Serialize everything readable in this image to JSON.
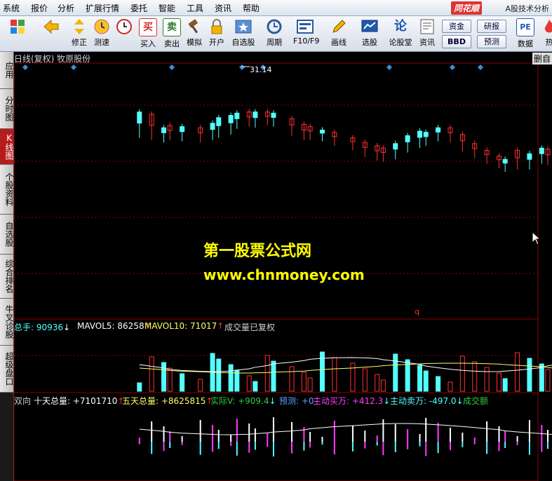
{
  "menu": [
    "系统",
    "报价",
    "分析",
    "扩展行情",
    "委托",
    "智能",
    "工具",
    "资讯",
    "帮助"
  ],
  "brand": {
    "logo_text": "同花顺",
    "subtitle": "A股技术分析"
  },
  "toolbar": {
    "buttons": [
      {
        "label": "",
        "icon": "windows-icon"
      },
      {
        "label": "",
        "icon": "back-arrow-icon"
      },
      {
        "label": "修正",
        "icon": "up-down-arrows-icon"
      },
      {
        "label": "测速",
        "icon": "clock-icon"
      },
      {
        "label": "买入",
        "icon": "buy-icon",
        "glyph": "买"
      },
      {
        "label": "卖出",
        "icon": "sell-icon",
        "glyph": "卖"
      },
      {
        "label": "模拟",
        "icon": "gavel-icon"
      },
      {
        "label": "开户",
        "icon": "lock-icon"
      },
      {
        "label": "自选股",
        "icon": "star-icon"
      },
      {
        "label": "周期",
        "icon": "cycle-icon"
      },
      {
        "label": "F10/F9",
        "icon": "f10-icon"
      },
      {
        "label": "画线",
        "icon": "pencil-icon"
      },
      {
        "label": "选股",
        "icon": "screen-icon"
      },
      {
        "label": "论股堂",
        "icon": "forum-icon"
      },
      {
        "label": "资讯",
        "icon": "news-icon"
      }
    ],
    "small_buttons": [
      "资金",
      "研报",
      "BBD",
      "预测"
    ],
    "right_buttons": [
      {
        "label": "数据",
        "icon": "pe-icon",
        "glyph": "PE"
      },
      {
        "label": "热",
        "icon": "hot-icon"
      }
    ]
  },
  "sidebar": {
    "tabs": [
      "应用",
      "分时图",
      "K线图",
      "个股资料",
      "自选股",
      "综合排名",
      "牛叉诊股",
      "超级盘口"
    ],
    "active_index": 2
  },
  "chart_title": "日线(复权)  牧原股份",
  "corner_button": "删自",
  "price_high_label": "31.14",
  "price_low_marker": "q",
  "volume_legend": {
    "total": "总手: 90936",
    "total_arrow": "↓",
    "mavol5": "MAVOL5: 86258",
    "mavol5_arrow": "↑",
    "mavol10": "MAVOL10: 71017",
    "mavol10_arrow": "↑",
    "note": "成交量已复权"
  },
  "bottom_legend": {
    "title": "双向",
    "ten_day": "十天总量: +7101710",
    "ten_day_arrow": "↑",
    "five_day": "五天总量: +8625815",
    "five_day_arrow": "↑",
    "actual": "实际V: +909.4",
    "actual_arrow": "↓",
    "predict": "预测: +0",
    "buy": "主动买万: +412.3",
    "buy_arrow": "↓",
    "sell": "主动卖万: -497.0",
    "sell_arrow": "↓",
    "deal": "成交额"
  },
  "watermark": {
    "line1": "第一股票公式网",
    "line2": "www.chnmoney.com"
  },
  "colors": {
    "up": "#ff3030",
    "down": "#54ffff",
    "background": "#000000",
    "grid": "#8a0000",
    "ma5": "#ffffff",
    "ma10": "#ffff66",
    "marker": "#3a8fd8",
    "pink": "#ff3cff"
  },
  "candles": [
    [
      20,
      25,
      12,
      30,
      "d"
    ],
    [
      22,
      20,
      10,
      28,
      "u"
    ],
    [
      24,
      13,
      8,
      16,
      "d"
    ],
    [
      25,
      14,
      10,
      18,
      "u"
    ],
    [
      27,
      13,
      9,
      17,
      "d"
    ],
    [
      30,
      12,
      8,
      16,
      "u"
    ],
    [
      32,
      13,
      10,
      20,
      "d"
    ],
    [
      33,
      19,
      12,
      25,
      "d"
    ],
    [
      35,
      22,
      15,
      27,
      "d"
    ],
    [
      36,
      25,
      20,
      29,
      "d"
    ],
    [
      38,
      26,
      22,
      30,
      "u"
    ],
    [
      39,
      26,
      21,
      30,
      "d"
    ],
    [
      41,
      27,
      23,
      30,
      "u"
    ],
    [
      42,
      26,
      22,
      29,
      "d"
    ],
    [
      45,
      20,
      14,
      24,
      "u"
    ],
    [
      47,
      15,
      10,
      19,
      "u"
    ],
    [
      48,
      13,
      10,
      17,
      "u"
    ],
    [
      50,
      12,
      9,
      14,
      "d"
    ],
    [
      52,
      9,
      5,
      12,
      "u"
    ],
    [
      55,
      4,
      1,
      7,
      "u"
    ],
    [
      57,
      -1,
      -5,
      3,
      "u"
    ],
    [
      59,
      -4,
      -8,
      0,
      "u"
    ],
    [
      60,
      -6,
      -9,
      -2,
      "u"
    ],
    [
      62,
      -2,
      -7,
      2,
      "d"
    ],
    [
      64,
      4,
      -1,
      9,
      "d"
    ],
    [
      66,
      8,
      3,
      13,
      "d"
    ],
    [
      67,
      9,
      5,
      12,
      "d"
    ],
    [
      69,
      13,
      9,
      16,
      "d"
    ],
    [
      71,
      12,
      8,
      16,
      "u"
    ],
    [
      73,
      5,
      0,
      10,
      "u"
    ],
    [
      75,
      -2,
      -6,
      2,
      "u"
    ],
    [
      77,
      -8,
      -11,
      -4,
      "u"
    ],
    [
      79,
      -12,
      -15,
      -9,
      "u"
    ],
    [
      80,
      -15,
      -18,
      -12,
      "d"
    ],
    [
      82,
      -8,
      -16,
      -4,
      "u"
    ],
    [
      84,
      -12,
      -16,
      -7,
      "d"
    ],
    [
      86,
      -6,
      -11,
      -2,
      "d"
    ],
    [
      87,
      -8,
      -12,
      -3,
      "u"
    ],
    [
      89,
      -6,
      -9,
      -2,
      "d"
    ],
    [
      91,
      -2,
      -6,
      3,
      "d"
    ],
    [
      93,
      2,
      -2,
      7,
      "d"
    ],
    [
      95,
      -3,
      -6,
      1,
      "u"
    ],
    [
      96,
      -4,
      -8,
      0,
      "u"
    ],
    [
      98,
      -6,
      -10,
      -2,
      "d"
    ],
    [
      100,
      1,
      -2,
      5,
      "d"
    ],
    [
      102,
      0,
      -4,
      4,
      "u"
    ],
    [
      104,
      4,
      0,
      8,
      "d"
    ],
    [
      106,
      0,
      -3,
      4,
      "u"
    ],
    [
      107,
      4,
      1,
      8,
      "d"
    ],
    [
      109,
      2,
      -1,
      6,
      "d"
    ],
    [
      111,
      2,
      -2,
      6,
      "u"
    ],
    [
      113,
      3,
      0,
      7,
      "d"
    ],
    [
      115,
      7,
      3,
      11,
      "d"
    ],
    [
      116,
      13,
      9,
      17,
      "d"
    ],
    [
      118,
      19,
      15,
      23,
      "d"
    ],
    [
      120,
      23,
      19,
      27,
      "d"
    ],
    [
      122,
      27,
      21,
      31,
      "d"
    ],
    [
      124,
      30,
      26,
      34,
      "d"
    ],
    [
      126,
      27,
      23,
      31,
      "u"
    ],
    [
      127,
      25,
      21,
      29,
      "d"
    ],
    [
      129,
      25,
      21,
      29,
      "u"
    ],
    [
      131,
      22,
      18,
      26,
      "u"
    ],
    [
      133,
      26,
      22,
      30,
      "d"
    ],
    [
      135,
      22,
      18,
      26,
      "u"
    ],
    [
      136,
      26,
      22,
      30,
      "d"
    ],
    [
      138,
      27,
      23,
      31,
      "d"
    ],
    [
      140,
      30,
      26,
      34,
      "d"
    ],
    [
      142,
      32,
      28,
      36,
      "d"
    ],
    [
      144,
      27,
      23,
      31,
      "u"
    ],
    [
      146,
      23,
      19,
      27,
      "u"
    ],
    [
      147,
      19,
      15,
      23,
      "u"
    ],
    [
      149,
      15,
      11,
      19,
      "u"
    ],
    [
      151,
      11,
      7,
      15,
      "u"
    ],
    [
      153,
      8,
      4,
      12,
      "u"
    ],
    [
      155,
      4,
      0,
      8,
      "u"
    ],
    [
      156,
      2,
      -2,
      6,
      "d"
    ],
    [
      158,
      0,
      -4,
      4,
      "u"
    ],
    [
      160,
      4,
      0,
      8,
      "d"
    ],
    [
      162,
      2,
      -2,
      6,
      "u"
    ],
    [
      164,
      -6,
      -10,
      -2,
      "u"
    ],
    [
      166,
      -7,
      -11,
      -3,
      "d"
    ],
    [
      167,
      -5,
      -9,
      -1,
      "u"
    ],
    [
      169,
      -3,
      -7,
      1,
      "d"
    ],
    [
      171,
      -1,
      -5,
      3,
      "d"
    ],
    [
      173,
      -3,
      -7,
      1,
      "u"
    ],
    [
      175,
      -2,
      -6,
      2,
      "d"
    ],
    [
      176,
      1,
      -3,
      5,
      "d"
    ],
    [
      178,
      5,
      1,
      9,
      "d"
    ]
  ],
  "markers": [
    36,
    105,
    245,
    345,
    375,
    555,
    645,
    685
  ]
}
